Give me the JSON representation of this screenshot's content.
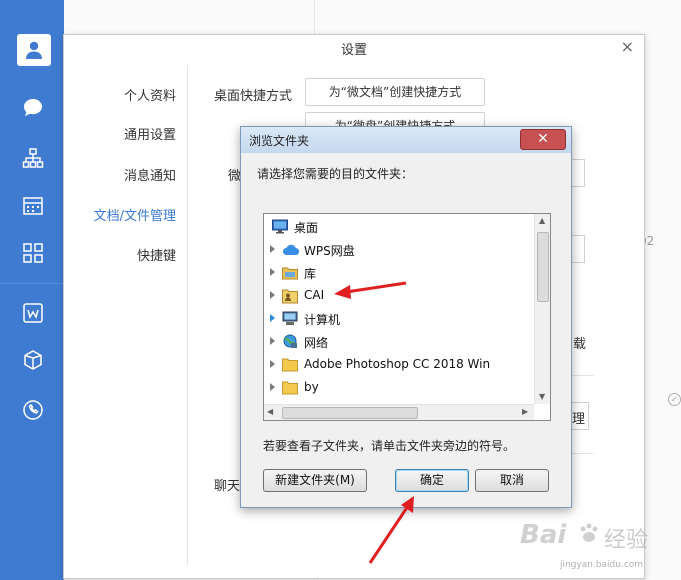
{
  "settings": {
    "title": "设置",
    "close": "×",
    "nav": [
      {
        "label": "个人资料",
        "active": false
      },
      {
        "label": "通用设置",
        "active": false
      },
      {
        "label": "消息通知",
        "active": false
      },
      {
        "label": "文档/文件管理",
        "active": true
      },
      {
        "label": "快捷键",
        "active": false
      }
    ],
    "shortcut_label": "桌面快捷方式",
    "btn_doc_shortcut": "为“微文档”创建快捷方式",
    "btn_disk_shortcut": "为“微盘”创建快捷方式",
    "peek_wei": "微",
    "peek_zai": "载",
    "peek_li": "理",
    "peek_chat": "聊天"
  },
  "background": {
    "peek_02": "02"
  },
  "dialog": {
    "title": "浏览文件夹",
    "close": "✕",
    "prompt": "请选择您需要的目的文件夹：",
    "tree": [
      {
        "label": "桌面",
        "icon": "desktop-icon",
        "expandable": false
      },
      {
        "label": "WPS网盘",
        "icon": "cloud-icon",
        "expandable": true
      },
      {
        "label": "库",
        "icon": "library-icon",
        "expandable": true
      },
      {
        "label": "CAI",
        "icon": "user-folder-icon",
        "expandable": true
      },
      {
        "label": "计算机",
        "icon": "computer-icon",
        "expandable": true
      },
      {
        "label": "网络",
        "icon": "network-icon",
        "expandable": true
      },
      {
        "label": "Adobe Photoshop CC 2018 Win",
        "icon": "folder-icon",
        "expandable": true
      },
      {
        "label": "by",
        "icon": "folder-icon",
        "expandable": true
      }
    ],
    "hint": "若要查看子文件夹，请单击文件夹旁边的符号。",
    "btn_new_folder": "新建文件夹(M)",
    "btn_ok": "确定",
    "btn_cancel": "取消"
  },
  "watermark": {
    "brand": "Bai",
    "brand2": "经验",
    "site": "jingyan.baidu.com"
  },
  "colors": {
    "rail": "#3f7bd1",
    "accent": "#3b79d4",
    "arrow": "#e02020"
  }
}
